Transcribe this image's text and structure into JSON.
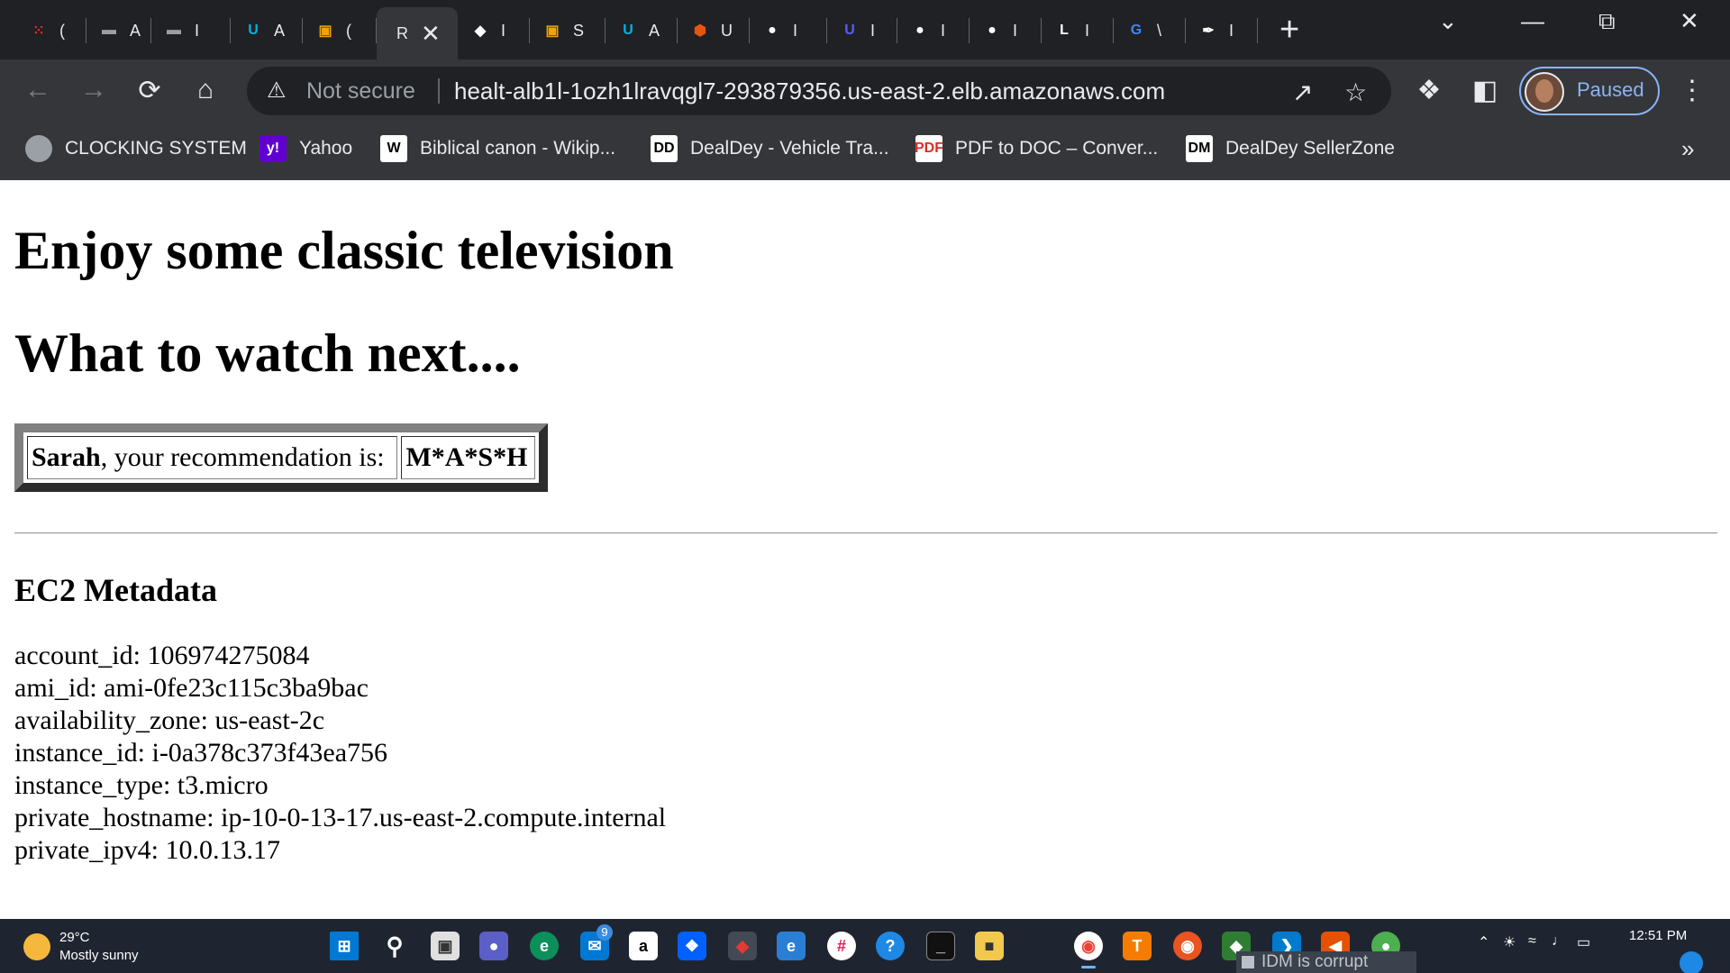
{
  "browser": {
    "tabs": [
      {
        "title": "(",
        "icon": "dotted-grid-icon",
        "color": "#d93025"
      },
      {
        "title": "A",
        "icon": "folder-icon",
        "color": "#9aa0a6"
      },
      {
        "title": "I",
        "icon": "folder-icon",
        "color": "#9aa0a6"
      },
      {
        "title": "A",
        "icon": "udacity-icon",
        "color": "#02b3e4"
      },
      {
        "title": "(",
        "icon": "aws-box-icon",
        "color": "#f0a30a"
      },
      {
        "title": "R",
        "icon": "",
        "color": "",
        "active": true
      },
      {
        "title": "I",
        "icon": "graduation-cap-icon",
        "color": "#ffffff"
      },
      {
        "title": "S",
        "icon": "aws-box-icon",
        "color": "#f0a30a"
      },
      {
        "title": "A",
        "icon": "udacity-icon",
        "color": "#02b3e4"
      },
      {
        "title": "U",
        "icon": "hexagon-icon",
        "color": "#e8550f"
      },
      {
        "title": "I",
        "icon": "github-icon",
        "color": "#ffffff"
      },
      {
        "title": "I",
        "icon": "udacity-icon",
        "color": "#5c5cff"
      },
      {
        "title": "I",
        "icon": "github-icon",
        "color": "#ffffff"
      },
      {
        "title": "I",
        "icon": "github-icon",
        "color": "#ffffff"
      },
      {
        "title": "I",
        "icon": "bold-l-icon",
        "color": "#ffffff"
      },
      {
        "title": "\\",
        "icon": "google-icon",
        "color": "#4285f4"
      },
      {
        "title": "I",
        "icon": "feather-icon",
        "color": "#ffffff"
      }
    ],
    "toolbar": {
      "security_label": "Not secure",
      "url": "healt-alb1l-1ozh1lravqgl7-293879356.us-east-2.elb.amazonaws.com",
      "profile_status": "Paused"
    },
    "bookmarks": [
      {
        "label": "CLOCKING SYSTEM",
        "icon": "globe-icon",
        "glyph": "",
        "bg": "#9aa0a6",
        "fg": "#35363a"
      },
      {
        "label": "Yahoo",
        "icon": "yahoo-icon",
        "glyph": "y!",
        "bg": "#6001d2",
        "fg": "#ffffff"
      },
      {
        "label": "Biblical canon - Wikip...",
        "icon": "wikipedia-icon",
        "glyph": "W",
        "bg": "#ffffff",
        "fg": "#000000"
      },
      {
        "label": "DealDey - Vehicle Tra...",
        "icon": "dealdey-icon",
        "glyph": "DD",
        "bg": "#ffffff",
        "fg": "#000000"
      },
      {
        "label": "PDF to DOC – Conver...",
        "icon": "pdf-doc-icon",
        "glyph": "PDF",
        "bg": "#ffffff",
        "fg": "#d93025"
      },
      {
        "label": "DealDey SellerZone",
        "icon": "dealdey-icon",
        "glyph": "DM",
        "bg": "#ffffff",
        "fg": "#000000"
      }
    ]
  },
  "page": {
    "heading1": "Enjoy some classic television",
    "heading2": "What to watch next....",
    "recommendation": {
      "name": "Sarah",
      "text": ", your recommendation is:",
      "show": "M*A*S*H"
    },
    "metadata_title": "EC2 Metadata",
    "metadata": [
      {
        "key": "account_id",
        "value": "106974275084"
      },
      {
        "key": "ami_id",
        "value": "ami-0fe23c115c3ba9bac"
      },
      {
        "key": "availability_zone",
        "value": "us-east-2c"
      },
      {
        "key": "instance_id",
        "value": "i-0a378c373f43ea756"
      },
      {
        "key": "instance_type",
        "value": "t3.micro"
      },
      {
        "key": "private_hostname",
        "value": "ip-10-0-13-17.us-east-2.compute.internal"
      },
      {
        "key": "private_ipv4",
        "value": "10.0.13.17"
      }
    ]
  },
  "taskbar": {
    "weather_temp": "29°C",
    "weather_desc": "Mostly sunny",
    "mail_badge": "9",
    "idm_notice": "IDM is corrupt",
    "clock": "12:51 PM"
  }
}
